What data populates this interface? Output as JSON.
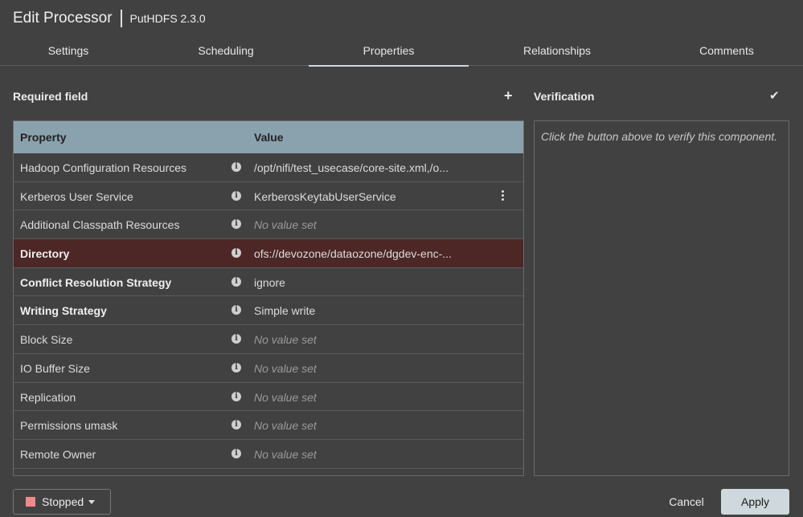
{
  "header": {
    "title": "Edit Processor",
    "subtitle": "PutHDFS 2.3.0"
  },
  "tabs": [
    {
      "label": "Settings"
    },
    {
      "label": "Scheduling"
    },
    {
      "label": "Properties",
      "active": true
    },
    {
      "label": "Relationships"
    },
    {
      "label": "Comments"
    }
  ],
  "properties": {
    "section_title": "Required field",
    "add_icon": "plus-icon",
    "columns": {
      "property": "Property",
      "value": "Value"
    },
    "rows": [
      {
        "name": "Hadoop Configuration Resources",
        "value": "/opt/nifi/test_usecase/core-site.xml,/o...",
        "required": false,
        "empty": false
      },
      {
        "name": "Kerberos User Service",
        "value": "KerberosKeytabUserService",
        "required": false,
        "empty": false,
        "menu": true
      },
      {
        "name": "Additional Classpath Resources",
        "value": "No value set",
        "required": false,
        "empty": true
      },
      {
        "name": "Directory",
        "value": "ofs://devozone/dataozone/dgdev-enc-...",
        "required": true,
        "empty": false,
        "selected": true
      },
      {
        "name": "Conflict Resolution Strategy",
        "value": "ignore",
        "required": true,
        "empty": false
      },
      {
        "name": "Writing Strategy",
        "value": "Simple write",
        "required": true,
        "empty": false
      },
      {
        "name": "Block Size",
        "value": "No value set",
        "required": false,
        "empty": true
      },
      {
        "name": "IO Buffer Size",
        "value": "No value set",
        "required": false,
        "empty": true
      },
      {
        "name": "Replication",
        "value": "No value set",
        "required": false,
        "empty": true
      },
      {
        "name": "Permissions umask",
        "value": "No value set",
        "required": false,
        "empty": true
      },
      {
        "name": "Remote Owner",
        "value": "No value set",
        "required": false,
        "empty": true
      }
    ]
  },
  "verification": {
    "title": "Verification",
    "verify_icon": "checkmark-icon",
    "hint": "Click the button above to verify this component."
  },
  "footer": {
    "status_label": "Stopped",
    "status_color": "#f08a8a",
    "cancel_label": "Cancel",
    "apply_label": "Apply"
  }
}
